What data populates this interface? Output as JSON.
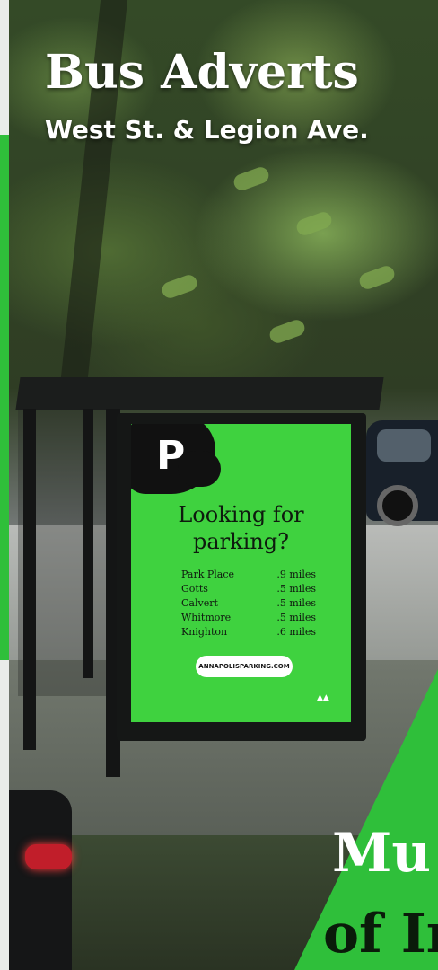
{
  "slide": {
    "title": "Bus Adverts",
    "subtitle": "West St. & Legion Ave."
  },
  "advert": {
    "logo_letter": "P",
    "headline_line1": "Looking for",
    "headline_line2": "parking?",
    "locations": [
      {
        "name": "Park Place",
        "distance": ".9 miles"
      },
      {
        "name": "Gotts",
        "distance": ".5 miles"
      },
      {
        "name": "Calvert",
        "distance": ".5 miles"
      },
      {
        "name": "Whitmore",
        "distance": ".5 miles"
      },
      {
        "name": "Knighton",
        "distance": ".6 miles"
      }
    ],
    "pill_text": "ANNAPOLISPARKING.COM"
  },
  "next_panel": {
    "line1": "Mu",
    "line2": "of In"
  },
  "colors": {
    "brand_green": "#3fd23f",
    "panel_green": "#2fbf3a",
    "ink": "#0e1a0e"
  }
}
